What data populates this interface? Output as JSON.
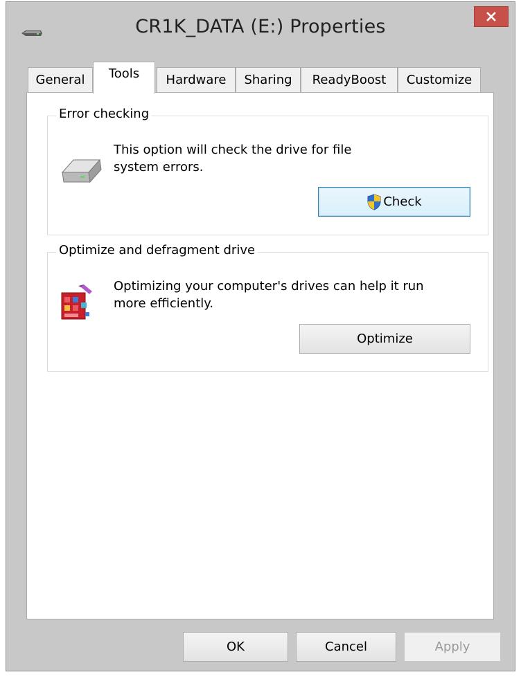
{
  "window": {
    "title": "CR1K_DATA (E:) Properties",
    "close_icon": "close-icon",
    "system_icon": "drive-icon"
  },
  "tabs": [
    {
      "label": "General",
      "active": false
    },
    {
      "label": "Tools",
      "active": true
    },
    {
      "label": "Hardware",
      "active": false
    },
    {
      "label": "Sharing",
      "active": false
    },
    {
      "label": "ReadyBoost",
      "active": false
    },
    {
      "label": "Customize",
      "active": false
    }
  ],
  "error_checking": {
    "group_label": "Error checking",
    "icon": "hard-drive-icon",
    "description_line1": "This option will check the drive for file",
    "description_line2": "system errors.",
    "button_label": "Check",
    "button_icon": "uac-shield-icon"
  },
  "optimize": {
    "group_label": "Optimize and defragment drive",
    "icon": "defragment-icon",
    "description_line1": "Optimizing your computer's drives can help it run",
    "description_line2": "more efficiently.",
    "button_label": "Optimize"
  },
  "footer": {
    "ok_label": "OK",
    "cancel_label": "Cancel",
    "apply_label": "Apply",
    "apply_enabled": false
  },
  "colors": {
    "close_button": "#c7504a",
    "focus_border": "#3c7fb1",
    "window_frame": "#c8c8c8"
  }
}
